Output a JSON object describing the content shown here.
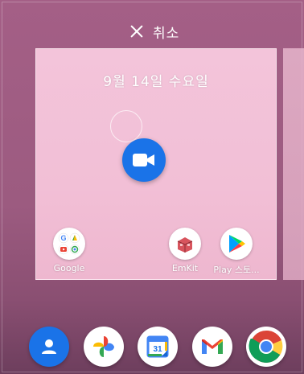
{
  "header": {
    "cancel_label": "취소",
    "cancel_icon": "close-icon"
  },
  "preview": {
    "date": "9월 14일 수요일",
    "dragged_app_icon": "google-meet-icon",
    "apps": [
      {
        "label": "Google",
        "icon": "google-folder-icon"
      },
      {
        "label": "EmKit",
        "icon": "emkit-icon"
      },
      {
        "label": "Play 스토...",
        "icon": "play-store-icon"
      }
    ]
  },
  "dock": [
    {
      "name": "contacts",
      "icon": "contacts-icon"
    },
    {
      "name": "photos",
      "icon": "google-photos-icon"
    },
    {
      "name": "calendar",
      "icon": "calendar-icon",
      "day": "31"
    },
    {
      "name": "gmail",
      "icon": "gmail-icon"
    },
    {
      "name": "chrome",
      "icon": "chrome-icon"
    }
  ],
  "colors": {
    "wallpaper": "#a45f86",
    "preview_bg": "#f3c4da",
    "meet_blue": "#1a73e8"
  }
}
